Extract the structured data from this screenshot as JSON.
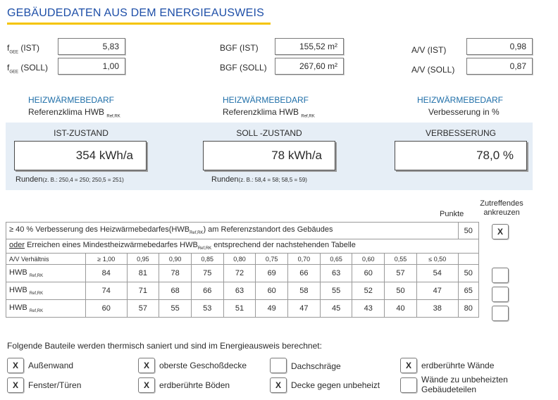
{
  "title": "GEBÄUDEDATEN AUS DEM ENERGIEAUSWEIS",
  "inputs": {
    "fgee_ist": {
      "label_main": "f",
      "label_sub": "GEE",
      "label_rest": " (IST)",
      "value": "5,83"
    },
    "fgee_soll": {
      "label_main": "f",
      "label_sub": "GEE",
      "label_rest": " (SOLL)",
      "value": "1,00"
    },
    "bgf_ist": {
      "label": "BGF (IST)",
      "value": "155,52 m²"
    },
    "bgf_soll": {
      "label": "BGF (SOLL)",
      "value": "267,60 m²"
    },
    "av_ist": {
      "label": "A/V (IST)",
      "value": "0,98"
    },
    "av_soll": {
      "label": "A/V (SOLL)",
      "value": "0,87"
    }
  },
  "heizwaerme": {
    "col1": {
      "title": "HEIZWÄRMEBEDARF",
      "sub_main": "Referenzklima HWB ",
      "sub_sub": "Ref,RK"
    },
    "col2": {
      "title": "HEIZWÄRMEBEDARF",
      "sub_main": "Referenzklima HWB ",
      "sub_sub": "Ref,RK"
    },
    "col3": {
      "title": "HEIZWÄRMEBEDARF",
      "sub": "Verbesserung in %"
    }
  },
  "states": {
    "ist": {
      "label": "IST-ZUSTAND",
      "value": "354 kWh/a",
      "runden": "Runden",
      "runden_hint": "(z. B.: 250,4 = 250; 250,5 = 251)"
    },
    "soll": {
      "label": "SOLL -ZUSTAND",
      "value": "78 kWh/a",
      "runden": "Runden",
      "runden_hint": "(z. B.: 58,4 = 58; 58,5 = 59)"
    },
    "verbesserung": {
      "label": "VERBESSERUNG",
      "value": "78,0 %"
    }
  },
  "table": {
    "punkte_header": "Punkte",
    "zutreffend_header_1": "Zutreffendes",
    "zutreffend_header_2": "ankreuzen",
    "row1": {
      "text_a": "≥ 40 % Verbesserung des Heizwärmebedarfes(HWB",
      "text_sub": "Ref,RK",
      "text_b": ") am Referenzstandort des Gebäudes",
      "punkte": "50",
      "checked": "X"
    },
    "row2": {
      "oder": "oder",
      "text_a": " Erreichen eines Mindestheizwärmebedarfes HWB",
      "text_sub": "Ref,RK",
      "text_b": " entsprechend der nachstehenden Tabelle"
    },
    "av_label": "A/V Verhältnis",
    "av_values": [
      "≥ 1,00",
      "0,95",
      "0,90",
      "0,85",
      "0,80",
      "0,75",
      "0,70",
      "0,65",
      "0,60",
      "0,55",
      "≤ 0,50"
    ],
    "hwb_rows": [
      {
        "label": "HWB ",
        "sub": "Ref,RK",
        "values": [
          "84",
          "81",
          "78",
          "75",
          "72",
          "69",
          "66",
          "63",
          "60",
          "57",
          "54"
        ],
        "punkte": "50",
        "checked": ""
      },
      {
        "label": "HWB ",
        "sub": "Ref,RK",
        "values": [
          "74",
          "71",
          "68",
          "66",
          "63",
          "60",
          "58",
          "55",
          "52",
          "50",
          "47"
        ],
        "punkte": "65",
        "checked": ""
      },
      {
        "label": "HWB ",
        "sub": "Ref,RK",
        "values": [
          "60",
          "57",
          "55",
          "53",
          "51",
          "49",
          "47",
          "45",
          "43",
          "40",
          "38"
        ],
        "punkte": "80",
        "checked": ""
      }
    ]
  },
  "components": {
    "intro": "Folgende Bauteile werden thermisch saniert und sind im Energieausweis berechnet:",
    "items": [
      {
        "label": "Außenwand",
        "checked": "X"
      },
      {
        "label": "oberste Geschoßdecke",
        "checked": "X"
      },
      {
        "label": "Dachschräge",
        "checked": ""
      },
      {
        "label": "erdberührte Wände",
        "checked": "X"
      },
      {
        "label": "Fenster/Türen",
        "checked": "X"
      },
      {
        "label": "erdberührte Böden",
        "checked": "X"
      },
      {
        "label": "Decke gegen unbeheizt",
        "checked": "X"
      },
      {
        "label": "Wände zu unbeheizten",
        "label2": "Gebäudeteilen",
        "checked": ""
      }
    ]
  }
}
